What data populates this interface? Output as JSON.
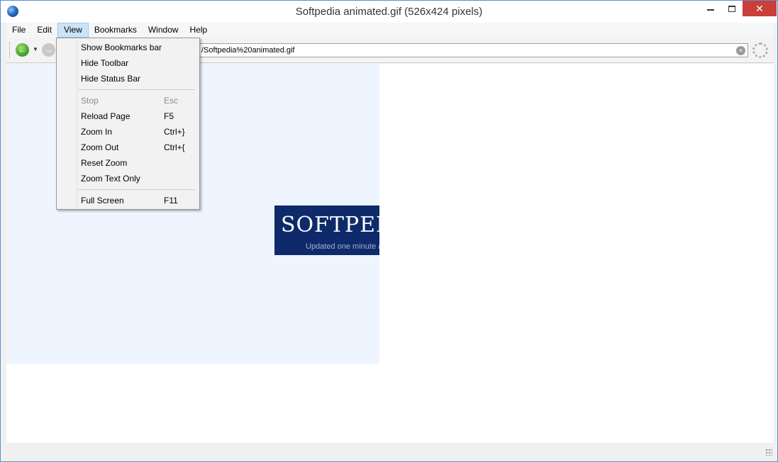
{
  "window": {
    "title": "Softpedia animated.gif (526x424 pixels)",
    "close_glyph": "✕"
  },
  "menubar": {
    "items": [
      "File",
      "Edit",
      "View",
      "Bookmarks",
      "Window",
      "Help"
    ]
  },
  "toolbar": {
    "url": "/Softpedia%20animated.gif",
    "back_glyph": "←",
    "forward_glyph": "→",
    "dropdown_glyph": "▼",
    "clear_glyph": "×"
  },
  "content": {
    "banner_title": "SOFTPEDIA",
    "banner_subtitle": "Updated one minute ago"
  },
  "view_menu": {
    "items": [
      {
        "label": "Show Bookmarks bar",
        "shortcut": "",
        "enabled": true
      },
      {
        "label": "Hide Toolbar",
        "shortcut": "",
        "enabled": true
      },
      {
        "label": "Hide Status Bar",
        "shortcut": "",
        "enabled": true
      },
      {
        "label": "Stop",
        "shortcut": "Esc",
        "enabled": false
      },
      {
        "label": "Reload Page",
        "shortcut": "F5",
        "enabled": true
      },
      {
        "label": "Zoom In",
        "shortcut": "Ctrl+}",
        "enabled": true
      },
      {
        "label": "Zoom Out",
        "shortcut": "Ctrl+{",
        "enabled": true
      },
      {
        "label": "Reset Zoom",
        "shortcut": "",
        "enabled": true
      },
      {
        "label": "Zoom Text Only",
        "shortcut": "",
        "enabled": true
      },
      {
        "label": "Full Screen",
        "shortcut": "F11",
        "enabled": true
      }
    ]
  },
  "colors": {
    "close_button": "#c9403a",
    "menu_active": "#cce4f7",
    "banner_bg": "#0e2a6a"
  }
}
